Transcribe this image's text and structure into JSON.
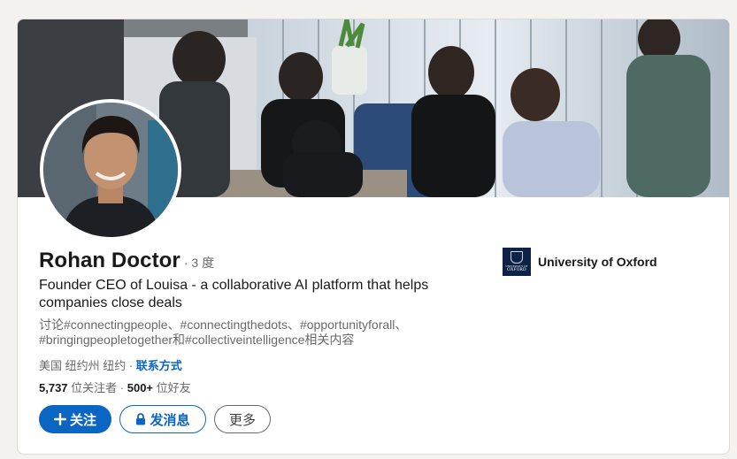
{
  "profile": {
    "name": "Rohan Doctor",
    "degree": "· 3 度",
    "headline": "Founder CEO of Louisa - a collaborative AI platform that helps companies close deals",
    "topics_line1": "讨论#connectingpeople、#connectingthedots、#opportunityforall、",
    "topics_line2": "#bringingpeopletogether和#collectiveintelligence相关内容",
    "location": "美国 纽约州 纽约 · ",
    "contact_label": "联系方式",
    "followers_count": "5,737",
    "followers_label": " 位关注者",
    "connections_prefix": " · ",
    "connections_count": "500+",
    "connections_label": " 位好友"
  },
  "actions": {
    "follow_label": "关注",
    "message_label": "发消息",
    "more_label": "更多"
  },
  "education": {
    "name": "University of Oxford",
    "logo_text_1": "UNIVERSITY OF",
    "logo_text_2": "OXFORD"
  },
  "colors": {
    "brand_blue": "#0a66c2",
    "page_bg": "#f3f2ef",
    "oxford_navy": "#0c2347"
  },
  "icons": {
    "follow": "plus-icon",
    "message": "lock-icon"
  }
}
